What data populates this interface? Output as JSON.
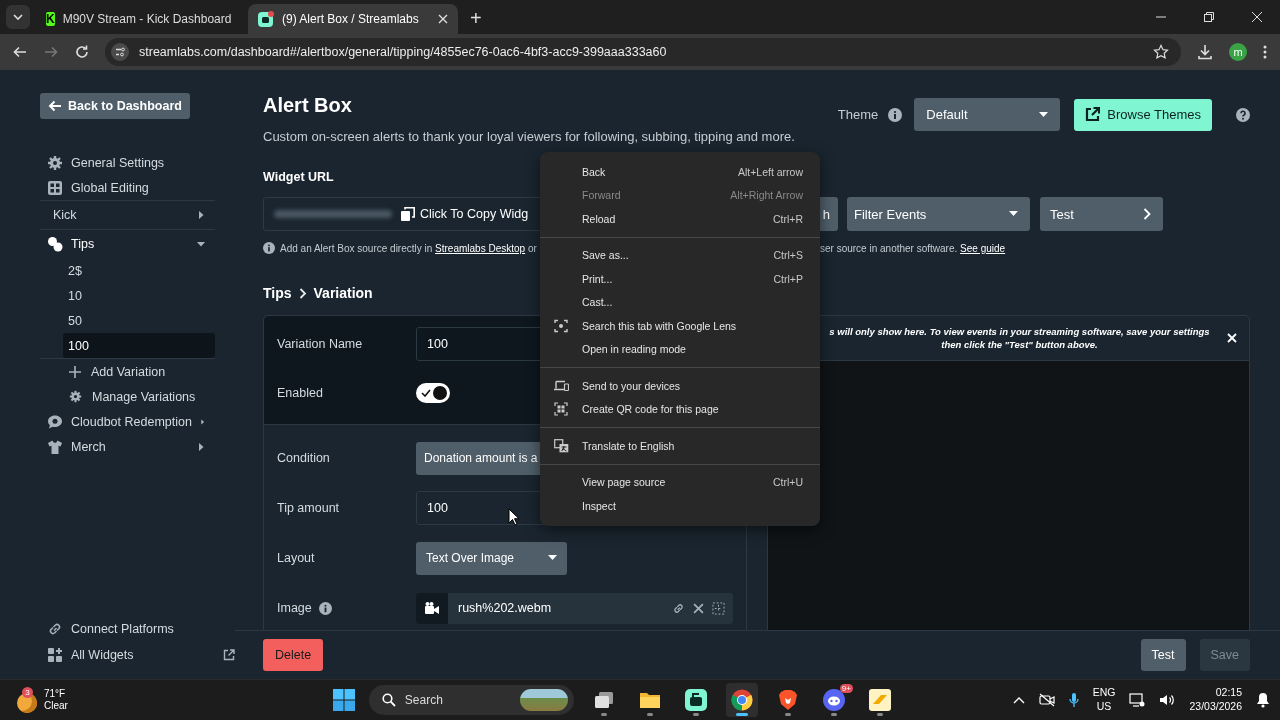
{
  "browser": {
    "tabs": [
      {
        "title": "M90V Stream - Kick Dashboard",
        "logo_text": "K",
        "selected": false
      },
      {
        "title": "(9) Alert Box / Streamlabs",
        "selected": true
      }
    ],
    "new_tab": "+",
    "address": "streamlabs.com/dashboard#/alertbox/general/tipping/4855ec76-0ac6-4bf3-acc9-399aaa333a60",
    "profile_initial": "m"
  },
  "sidebar": {
    "back_button": "Back to Dashboard",
    "items": [
      {
        "label": "General Settings",
        "kind": "gear"
      },
      {
        "label": "Global Editing",
        "kind": "grid"
      },
      {
        "label": "Kick",
        "kind": "plain",
        "expanded": false
      },
      {
        "label": "Tips",
        "kind": "tips",
        "expanded": true,
        "children": [
          {
            "label": "2$",
            "selected": false
          },
          {
            "label": "10",
            "selected": false
          },
          {
            "label": "50",
            "selected": false
          },
          {
            "label": "100",
            "selected": true
          }
        ],
        "actions": [
          {
            "label": "Add Variation",
            "kind": "plus"
          },
          {
            "label": "Manage Variations",
            "kind": "gear"
          }
        ]
      },
      {
        "label": "Cloudbot Redemption",
        "kind": "chat",
        "expanded": false
      },
      {
        "label": "Merch",
        "kind": "shirt",
        "expanded": false
      }
    ],
    "footer": [
      {
        "label": "Connect Platforms",
        "kind": "link"
      },
      {
        "label": "All Widgets",
        "kind": "widgets"
      }
    ]
  },
  "header": {
    "title": "Alert Box",
    "description": "Custom on-screen alerts to thank your loyal viewers for following, subbing, tipping and more.",
    "theme_label": "Theme",
    "theme_value": "Default",
    "browse_button": "Browse Themes"
  },
  "widget_url": {
    "label": "Widget URL",
    "copy_text": "Click To Copy Widg"
  },
  "toolbar": [
    {
      "label": "h",
      "kind": "button"
    },
    {
      "label": "Filter Events",
      "kind": "dropdown"
    },
    {
      "label": "Test",
      "kind": "next"
    }
  ],
  "info": {
    "before": "Add an Alert Box source directly in",
    "link": "Streamlabs Desktop",
    "after": "or",
    "rest": "ser source in another software.",
    "rest_link": "See guide"
  },
  "breadcrumb": [
    "Tips",
    "Variation"
  ],
  "form": {
    "sections": [
      [
        {
          "label": "Variation Name",
          "kind": "input",
          "value": "100"
        },
        {
          "label": "Enabled",
          "kind": "toggle",
          "checked": true
        }
      ],
      [
        {
          "label": "Condition",
          "kind": "select",
          "value": "Donation amount is a"
        },
        {
          "label": "Tip amount",
          "kind": "input",
          "value": "100"
        },
        {
          "label": "Layout",
          "kind": "dropdown",
          "value": "Text Over Image"
        },
        {
          "label": "Image",
          "kind": "media",
          "value": "rush%202.webm",
          "info": true
        }
      ]
    ]
  },
  "preview": {
    "note": "s will only show here. To view events in your streaming software, save your settings then click the \"Test\" button above."
  },
  "actions": {
    "delete": "Delete",
    "test": "Test",
    "save": "Save",
    "save_disabled": true
  },
  "context_menu": {
    "groups": [
      [
        {
          "label": "Back",
          "shortcut": "Alt+Left arrow",
          "disabled": false,
          "kind": "plain"
        },
        {
          "label": "Forward",
          "shortcut": "Alt+Right Arrow",
          "disabled": true,
          "kind": "plain"
        },
        {
          "label": "Reload",
          "shortcut": "Ctrl+R",
          "disabled": false,
          "kind": "plain"
        }
      ],
      [
        {
          "label": "Save as...",
          "shortcut": "Ctrl+S",
          "disabled": false,
          "kind": "plain"
        },
        {
          "label": "Print...",
          "shortcut": "Ctrl+P",
          "disabled": false,
          "kind": "plain"
        },
        {
          "label": "Cast...",
          "disabled": false,
          "kind": "plain"
        },
        {
          "label": "Search this tab with Google Lens",
          "disabled": false,
          "kind": "lens"
        },
        {
          "label": "Open in reading mode",
          "disabled": false,
          "kind": "plain"
        }
      ],
      [
        {
          "label": "Send to your devices",
          "disabled": false,
          "kind": "devices"
        },
        {
          "label": "Create QR code for this page",
          "disabled": false,
          "kind": "qr"
        }
      ],
      [
        {
          "label": "Translate to English",
          "disabled": false,
          "kind": "translate"
        }
      ],
      [
        {
          "label": "View page source",
          "shortcut": "Ctrl+U",
          "disabled": false,
          "kind": "plain"
        },
        {
          "label": "Inspect",
          "disabled": false,
          "kind": "plain"
        }
      ]
    ]
  },
  "taskbar": {
    "weather_badge": "3",
    "temperature": "71°F",
    "condition": "Clear",
    "search_placeholder": "Search",
    "apps": [
      {
        "kind": "taskview",
        "active": false
      },
      {
        "kind": "folder",
        "active": false
      },
      {
        "kind": "green",
        "active": false
      },
      {
        "kind": "chrome",
        "active": true
      },
      {
        "kind": "brave",
        "active": false
      },
      {
        "kind": "discord",
        "active": false,
        "badge": "9+"
      },
      {
        "kind": "yellow",
        "active": false
      }
    ],
    "language": "ENG",
    "region": "US",
    "time": "02:15",
    "date": "23/03/2026"
  }
}
